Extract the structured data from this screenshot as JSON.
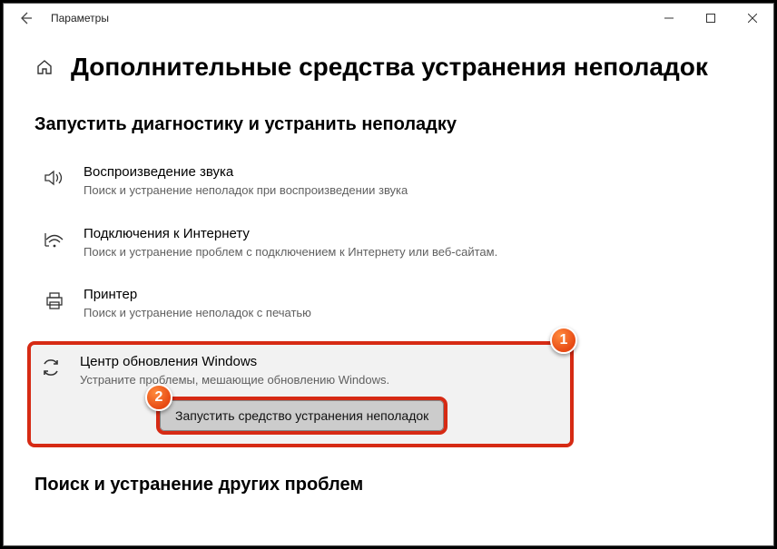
{
  "window": {
    "title": "Параметры"
  },
  "header": {
    "page_title": "Дополнительные средства устранения неполадок"
  },
  "section1": {
    "title": "Запустить диагностику и устранить неполадку",
    "items": [
      {
        "title": "Воспроизведение звука",
        "desc": "Поиск и устранение неполадок при воспроизведении звука"
      },
      {
        "title": "Подключения к Интернету",
        "desc": "Поиск и устранение проблем с подключением к Интернету или веб-сайтам."
      },
      {
        "title": "Принтер",
        "desc": "Поиск и устранение неполадок с печатью"
      },
      {
        "title": "Центр обновления Windows",
        "desc": "Устраните проблемы, мешающие обновлению Windows."
      }
    ],
    "run_button": "Запустить средство устранения неполадок"
  },
  "section2": {
    "title": "Поиск и устранение других проблем"
  },
  "callouts": {
    "one": "1",
    "two": "2"
  }
}
